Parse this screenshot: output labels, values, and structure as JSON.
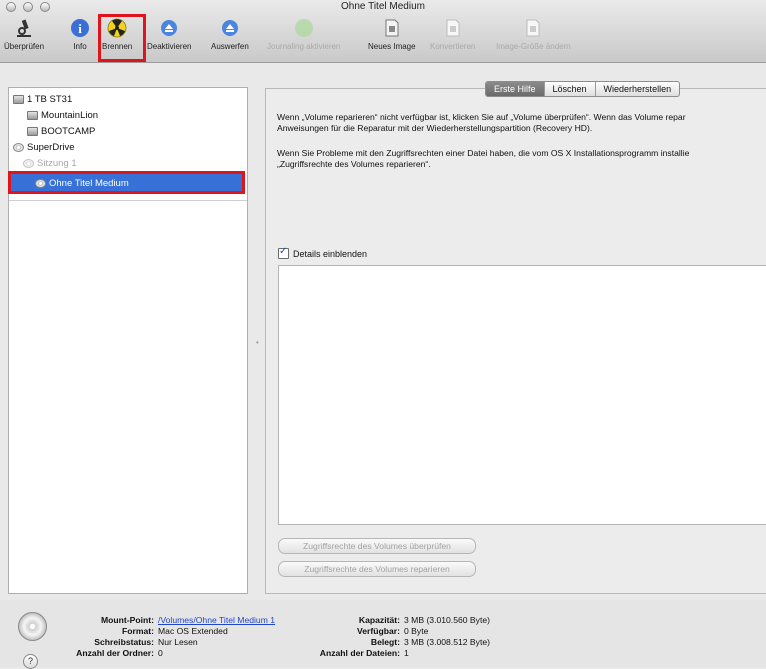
{
  "window": {
    "title": "Ohne Titel Medium"
  },
  "toolbar": {
    "items": [
      {
        "label": "Überprüfen",
        "icon": "microscope-icon"
      },
      {
        "label": "Info",
        "icon": "info-icon"
      },
      {
        "label": "Brennen",
        "icon": "burn-icon"
      },
      {
        "label": "Deaktivieren",
        "icon": "eject-disable-icon"
      },
      {
        "label": "Auswerfen",
        "icon": "eject-icon"
      },
      {
        "label": "Journaling aktivieren",
        "icon": "journaling-icon"
      },
      {
        "label": "Neues Image",
        "icon": "new-image-icon"
      },
      {
        "label": "Konvertieren",
        "icon": "convert-icon"
      },
      {
        "label": "Image-Größe ändern",
        "icon": "resize-image-icon"
      }
    ]
  },
  "sidebar": {
    "items": [
      {
        "label": "1 TB ST31"
      },
      {
        "label": "MountainLion"
      },
      {
        "label": "BOOTCAMP"
      },
      {
        "label": "SuperDrive"
      },
      {
        "label": "Sitzung 1"
      },
      {
        "label": "Ohne Titel Medium"
      }
    ]
  },
  "tabs": [
    {
      "label": "Erste Hilfe"
    },
    {
      "label": "Löschen"
    },
    {
      "label": "Wiederherstellen"
    }
  ],
  "firstaid": {
    "para1_line1": "Wenn „Volume reparieren“ nicht verfügbar ist, klicken Sie auf „Volume überprüfen“. Wenn das Volume repar",
    "para1_line2": "Anweisungen für die Reparatur mit der Wiederherstellungspartition (Recovery HD).",
    "para2_line1": "Wenn Sie Probleme mit den Zugriffsrechten einer Datei haben, die vom OS X Installationsprogramm installie",
    "para2_line2": "„Zugriffsrechte des Volumes reparieren“.",
    "details_label": "Details einblenden",
    "verify_permissions": "Zugriffsrechte des Volumes überprüfen",
    "repair_permissions": "Zugriffsrechte des Volumes reparieren"
  },
  "info": {
    "mount_point_label": "Mount-Point:",
    "mount_point_value": "/Volumes/Ohne Titel Medium 1",
    "format_label": "Format:",
    "format_value": "Mac OS Extended",
    "write_status_label": "Schreibstatus:",
    "write_status_value": "Nur Lesen",
    "folders_label": "Anzahl der Ordner:",
    "folders_value": "0",
    "capacity_label": "Kapazität:",
    "capacity_value": "3 MB (3.010.560 Byte)",
    "available_label": "Verfügbar:",
    "available_value": "0 Byte",
    "used_label": "Belegt:",
    "used_value": "3 MB (3.008.512 Byte)",
    "files_label": "Anzahl der Dateien:",
    "files_value": "1"
  },
  "help": {
    "glyph": "?"
  },
  "colors": {
    "highlight": "#e0141b",
    "selection": "#3770d7",
    "link": "#2046c8"
  }
}
